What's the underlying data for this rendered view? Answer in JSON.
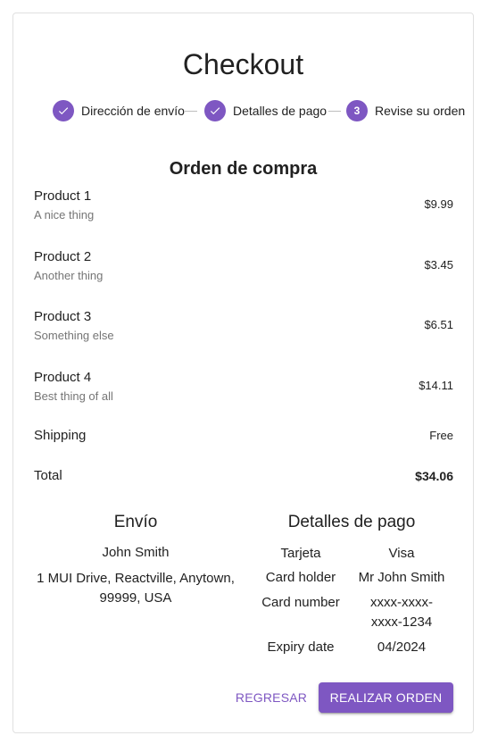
{
  "colors": {
    "accent": "#7e57c2",
    "text": "#212121",
    "secondary_text": "#757575",
    "connector": "#bdbdbd"
  },
  "title": "Checkout",
  "stepper": {
    "steps": [
      {
        "label": "Dirección de envío",
        "state": "completed",
        "icon": "check-icon"
      },
      {
        "label": "Detalles de pago",
        "state": "completed",
        "icon": "check-icon"
      },
      {
        "label": "Revise su orden",
        "state": "active",
        "number": "3"
      }
    ]
  },
  "order": {
    "heading": "Orden de compra",
    "products": [
      {
        "name": "Product 1",
        "desc": "A nice thing",
        "price": "$9.99"
      },
      {
        "name": "Product 2",
        "desc": "Another thing",
        "price": "$3.45"
      },
      {
        "name": "Product 3",
        "desc": "Something else",
        "price": "$6.51"
      },
      {
        "name": "Product 4",
        "desc": "Best thing of all",
        "price": "$14.11"
      }
    ],
    "shipping": {
      "label": "Shipping",
      "value": "Free"
    },
    "total": {
      "label": "Total",
      "value": "$34.06"
    }
  },
  "shipping_section": {
    "heading": "Envío",
    "name": "John Smith",
    "address": "1 MUI Drive, Reactville, Anytown, 99999, USA"
  },
  "payment_section": {
    "heading": "Detalles de pago",
    "rows": [
      {
        "key": "Tarjeta",
        "value": "Visa"
      },
      {
        "key": "Card holder",
        "value": "Mr John Smith"
      },
      {
        "key": "Card number",
        "value": "xxxx-xxxx-xxxx-1234"
      },
      {
        "key": "Expiry date",
        "value": "04/2024"
      }
    ]
  },
  "actions": {
    "back_label": "Regresar",
    "place_order_label": "Realizar orden"
  }
}
